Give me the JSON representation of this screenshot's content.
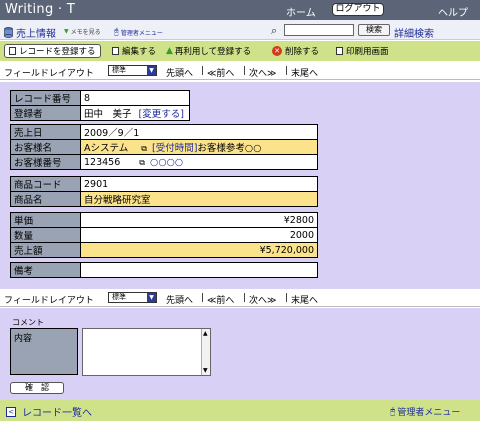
{
  "header": {
    "title": "Writing · T",
    "home": "ホーム",
    "logout": "ログアウト",
    "help": "ヘルプ"
  },
  "nav": {
    "sales_info": "売上情報",
    "memo": "メモを見る",
    "admin_menu_small": "管理者メニュー",
    "search_button": "検索",
    "advanced_search": "詳細検索",
    "search_value": ""
  },
  "actions": {
    "register": "レコードを登録する",
    "edit": "編集する",
    "reuse": "再利用して登録する",
    "delete": "削除する",
    "print": "印刷用画面"
  },
  "layout": {
    "label": "フィールドレイアウト",
    "select": "標準",
    "first": "先頭へ",
    "prev": "≪前へ",
    "next": "次へ≫",
    "last": "末尾へ",
    "sep": "|"
  },
  "record": {
    "record_no_label": "レコード番号",
    "record_no": "8",
    "registrant_label": "登録者",
    "registrant": "田中　美子",
    "change": "[変更する]",
    "sale_date_label": "売上日",
    "sale_date": "2009／9／1",
    "customer_label": "お客様名",
    "customer": "Aシステム",
    "reception": "[受付時間]",
    "customer_ref": "お客様参考○○",
    "customer_no_label": "お客様番号",
    "customer_no": "123456",
    "customer_no_link": "○○○○",
    "product_code_label": "商品コード",
    "product_code": "2901",
    "product_name_label": "商品名",
    "product_name": "自分戦略研究室",
    "unit_price_label": "単価",
    "unit_price": "¥2800",
    "quantity_label": "数量",
    "quantity": "2000",
    "sales_amount_label": "売上額",
    "sales_amount": "¥5,720,000",
    "remarks_label": "備考",
    "remarks": ""
  },
  "comment": {
    "section_label": "コメント",
    "content_label": "内容",
    "confirm": "確　認"
  },
  "footer": {
    "back": "レコード一覧へ",
    "admin_menu": "管理者メニュー"
  },
  "colors": {
    "titlebar": "#5c6578",
    "panel": "#d8d0f5",
    "actionbar": "#cfe28a",
    "key_cell": "#9aa3b3",
    "highlight": "#fbe38c",
    "link": "#1e2b98"
  }
}
